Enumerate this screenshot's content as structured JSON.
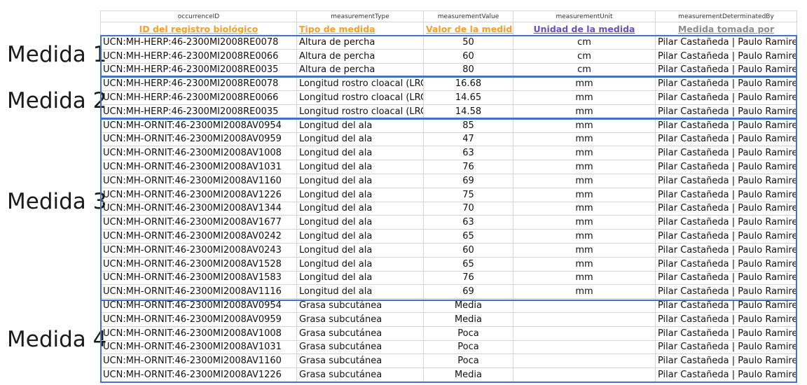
{
  "groups": [
    {
      "label": "Medida 1"
    },
    {
      "label": "Medida 2"
    },
    {
      "label": "Medida 3"
    },
    {
      "label": "Medida 4"
    }
  ],
  "header_fields": [
    "occurrenceID",
    "measurementType",
    "measurementValue",
    "measurementUnit",
    "measurementDeterminatedBy"
  ],
  "header_labels": [
    "ID del registro biológico",
    "Tipo de medida",
    "Valor de la medida",
    "Unidad de la medida",
    "Medida tomada por"
  ],
  "rows": [
    {
      "id": "UCN:MH-HERP:46-2300MI2008RE0078",
      "type": "Altura de percha",
      "value": "50",
      "unit": "cm",
      "by": "Pilar Castañeda | Paulo Ramirez"
    },
    {
      "id": "UCN:MH-HERP:46-2300MI2008RE0066",
      "type": "Altura de percha",
      "value": "60",
      "unit": "cm",
      "by": "Pilar Castañeda | Paulo Ramirez"
    },
    {
      "id": "UCN:MH-HERP:46-2300MI2008RE0035",
      "type": "Altura de percha",
      "value": "80",
      "unit": "cm",
      "by": "Pilar Castañeda | Paulo Ramirez"
    },
    {
      "id": "UCN:MH-HERP:46-2300MI2008RE0078",
      "type": "Longitud rostro cloacal (LRC)",
      "value": "16.68",
      "unit": "mm",
      "by": "Pilar Castañeda | Paulo Ramirez"
    },
    {
      "id": "UCN:MH-HERP:46-2300MI2008RE0066",
      "type": "Longitud rostro cloacal (LRC)",
      "value": "14.65",
      "unit": "mm",
      "by": "Pilar Castañeda | Paulo Ramirez"
    },
    {
      "id": "UCN:MH-HERP:46-2300MI2008RE0035",
      "type": "Longitud rostro cloacal (LRC)",
      "value": "14.58",
      "unit": "mm",
      "by": "Pilar Castañeda | Paulo Ramirez"
    },
    {
      "id": "UCN:MH-ORNIT:46-2300MI2008AV0954",
      "type": "Longitud del ala",
      "value": "85",
      "unit": "mm",
      "by": "Pilar Castañeda | Paulo Ramirez"
    },
    {
      "id": "UCN:MH-ORNIT:46-2300MI2008AV0959",
      "type": "Longitud del ala",
      "value": "47",
      "unit": "mm",
      "by": "Pilar Castañeda | Paulo Ramirez"
    },
    {
      "id": "UCN:MH-ORNIT:46-2300MI2008AV1008",
      "type": "Longitud del ala",
      "value": "63",
      "unit": "mm",
      "by": "Pilar Castañeda | Paulo Ramirez"
    },
    {
      "id": "UCN:MH-ORNIT:46-2300MI2008AV1031",
      "type": "Longitud del ala",
      "value": "76",
      "unit": "mm",
      "by": "Pilar Castañeda | Paulo Ramirez"
    },
    {
      "id": "UCN:MH-ORNIT:46-2300MI2008AV1160",
      "type": "Longitud del ala",
      "value": "69",
      "unit": "mm",
      "by": "Pilar Castañeda | Paulo Ramirez"
    },
    {
      "id": "UCN:MH-ORNIT:46-2300MI2008AV1226",
      "type": "Longitud del ala",
      "value": "75",
      "unit": "mm",
      "by": "Pilar Castañeda | Paulo Ramirez"
    },
    {
      "id": "UCN:MH-ORNIT:46-2300MI2008AV1344",
      "type": "Longitud del ala",
      "value": "70",
      "unit": "mm",
      "by": "Pilar Castañeda | Paulo Ramirez"
    },
    {
      "id": "UCN:MH-ORNIT:46-2300MI2008AV1677",
      "type": "Longitud del ala",
      "value": "63",
      "unit": "mm",
      "by": "Pilar Castañeda | Paulo Ramirez"
    },
    {
      "id": "UCN:MH-ORNIT:46-2300MI2008AV0242",
      "type": "Longitud del ala",
      "value": "65",
      "unit": "mm",
      "by": "Pilar Castañeda | Paulo Ramirez"
    },
    {
      "id": "UCN:MH-ORNIT:46-2300MI2008AV0243",
      "type": "Longitud del ala",
      "value": "60",
      "unit": "mm",
      "by": "Pilar Castañeda | Paulo Ramirez"
    },
    {
      "id": "UCN:MH-ORNIT:46-2300MI2008AV1528",
      "type": "Longitud del ala",
      "value": "65",
      "unit": "mm",
      "by": "Pilar Castañeda | Paulo Ramirez"
    },
    {
      "id": "UCN:MH-ORNIT:46-2300MI2008AV1583",
      "type": "Longitud del ala",
      "value": "76",
      "unit": "mm",
      "by": "Pilar Castañeda | Paulo Ramirez"
    },
    {
      "id": "UCN:MH-ORNIT:46-2300MI2008AV1116",
      "type": "Longitud del ala",
      "value": "69",
      "unit": "mm",
      "by": "Pilar Castañeda | Paulo Ramirez"
    },
    {
      "id": "UCN:MH-ORNIT:46-2300MI2008AV0954",
      "type": "Grasa subcutánea",
      "value": "Media",
      "unit": "",
      "by": "Pilar Castañeda | Paulo Ramirez"
    },
    {
      "id": "UCN:MH-ORNIT:46-2300MI2008AV0959",
      "type": "Grasa subcutánea",
      "value": "Media",
      "unit": "",
      "by": "Pilar Castañeda | Paulo Ramirez"
    },
    {
      "id": "UCN:MH-ORNIT:46-2300MI2008AV1008",
      "type": "Grasa subcutánea",
      "value": "Poca",
      "unit": "",
      "by": "Pilar Castañeda | Paulo Ramirez"
    },
    {
      "id": "UCN:MH-ORNIT:46-2300MI2008AV1031",
      "type": "Grasa subcutánea",
      "value": "Poca",
      "unit": "",
      "by": "Pilar Castañeda | Paulo Ramirez"
    },
    {
      "id": "UCN:MH-ORNIT:46-2300MI2008AV1160",
      "type": "Grasa subcutánea",
      "value": "Poca",
      "unit": "",
      "by": "Pilar Castañeda | Paulo Ramirez"
    },
    {
      "id": "UCN:MH-ORNIT:46-2300MI2008AV1226",
      "type": "Grasa subcutánea",
      "value": "Media",
      "unit": "",
      "by": "Pilar Castañeda | Paulo Ramirez"
    }
  ],
  "colors": {
    "header_orange": "#f7a021",
    "header_purple": "#6b4fbb",
    "header_gray": "#8c8c8c",
    "group_border": "#4472c4"
  }
}
